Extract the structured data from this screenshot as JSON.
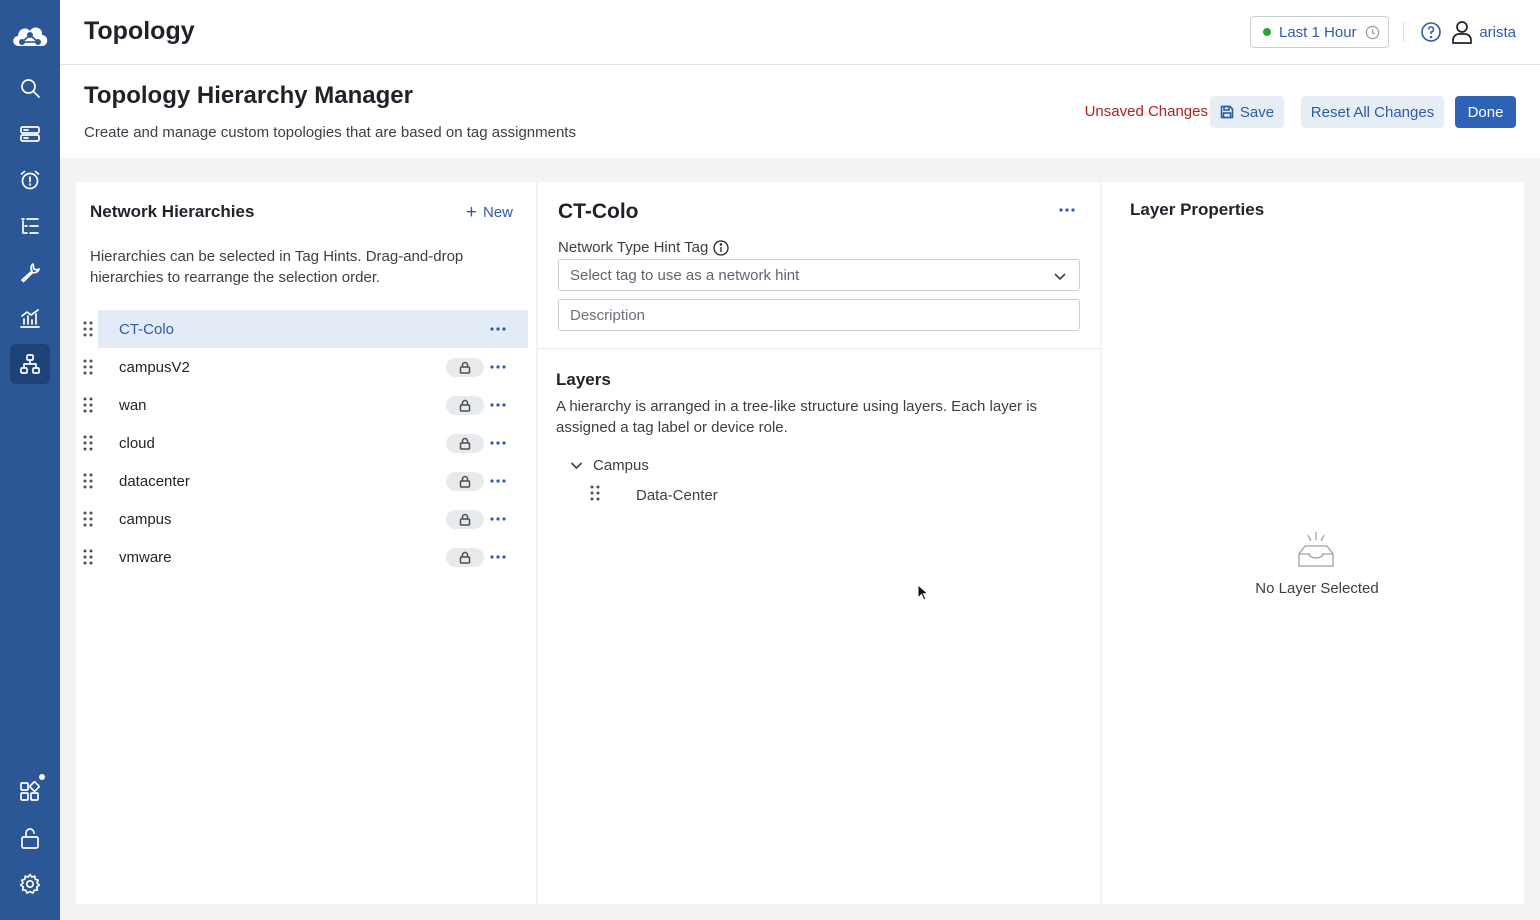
{
  "header": {
    "app_title": "Topology",
    "time_range": "Last 1 Hour",
    "user": "arista"
  },
  "sidebar": {
    "items": [
      {
        "icon": "search-icon"
      },
      {
        "icon": "devices-icon"
      },
      {
        "icon": "alarm-clock-icon"
      },
      {
        "icon": "list-icon"
      },
      {
        "icon": "wrench-icon"
      },
      {
        "icon": "dashboard-icon"
      },
      {
        "icon": "topology-icon",
        "active": true
      },
      {
        "icon": "apps-icon"
      },
      {
        "icon": "unlock-icon"
      },
      {
        "icon": "gear-icon"
      }
    ]
  },
  "page": {
    "title": "Topology Hierarchy Manager",
    "subtitle": "Create and manage custom topologies that are based on tag assignments",
    "unsaved": "Unsaved Changes",
    "save_label": "Save",
    "reset_label": "Reset All Changes",
    "done_label": "Done"
  },
  "hierarchies": {
    "title": "Network Hierarchies",
    "new_label": "New",
    "description": "Hierarchies can be selected in Tag Hints. Drag-and-drop hierarchies to rearrange the selection order.",
    "items": [
      {
        "name": "CT-Colo",
        "selected": true,
        "locked": false
      },
      {
        "name": "campusV2",
        "locked": true
      },
      {
        "name": "wan",
        "locked": true
      },
      {
        "name": "cloud",
        "locked": true
      },
      {
        "name": "datacenter",
        "locked": true
      },
      {
        "name": "campus",
        "locked": true
      },
      {
        "name": "vmware",
        "locked": true
      }
    ]
  },
  "editor": {
    "title": "CT-Colo",
    "hint_label": "Network Type Hint Tag",
    "hint_placeholder": "Select tag to use as a network hint",
    "description_placeholder": "Description",
    "layers_title": "Layers",
    "layers_description": "A hierarchy is arranged in a tree-like structure using layers. Each layer is assigned a tag label or device role.",
    "tree": {
      "root": "Campus",
      "child": "Data-Center"
    }
  },
  "properties": {
    "title": "Layer Properties",
    "empty_text": "No Layer Selected"
  },
  "colors": {
    "sidebar": "#2b5797",
    "accent": "#2d5ca8",
    "primary_button": "#2d62b5",
    "unsaved": "#b4201a",
    "status_ok": "#2aa52f"
  }
}
